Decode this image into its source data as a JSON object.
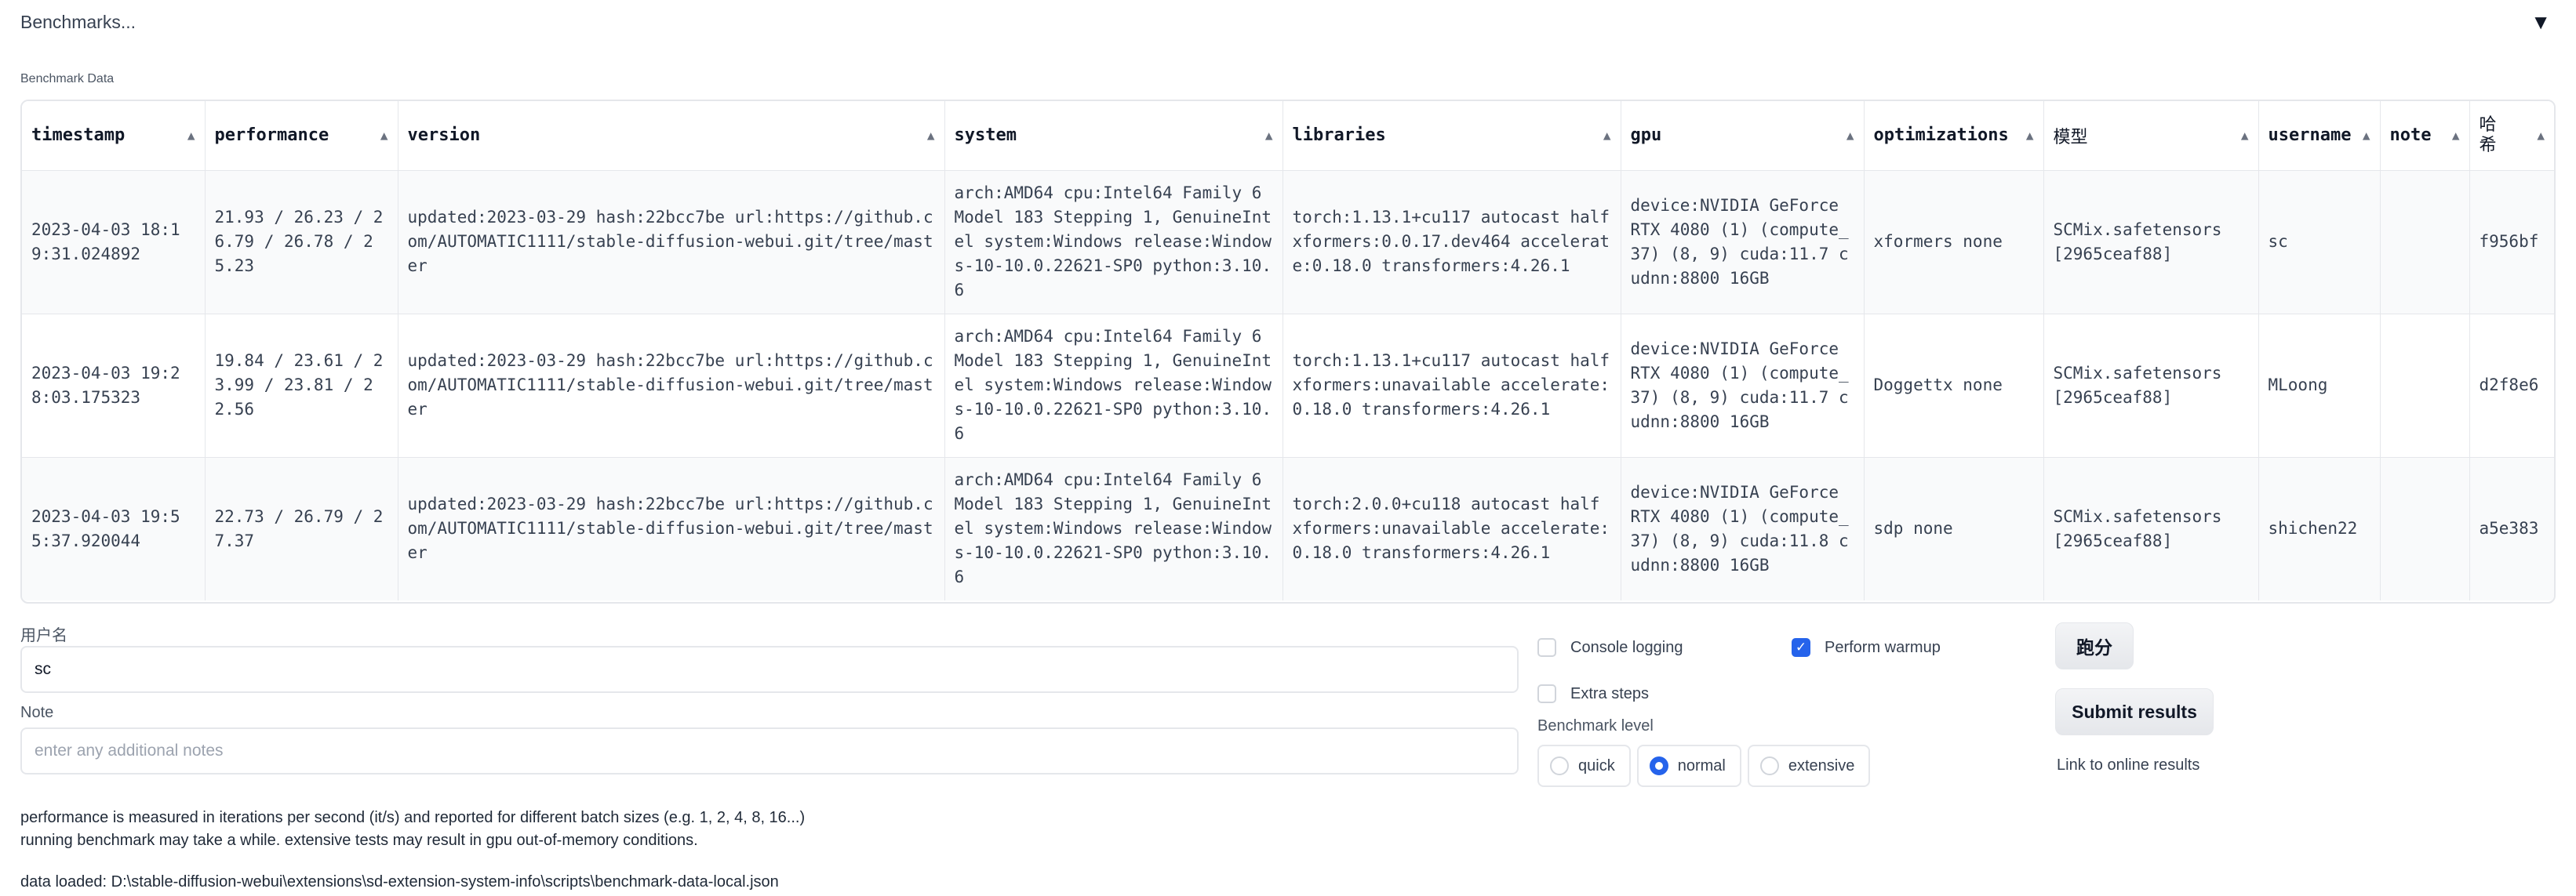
{
  "accordion": {
    "title": "Benchmarks...",
    "caret": "▼"
  },
  "block_label": "Benchmark Data",
  "table": {
    "headers": [
      "timestamp",
      "performance",
      "version",
      "system",
      "libraries",
      "gpu",
      "optimizations",
      "模型",
      "username",
      "note",
      "哈希"
    ],
    "sort_icon": "▲",
    "rows": [
      [
        "2023-04-03 18:19:31.024892",
        "21.93 / 26.23 / 26.79 / 26.78 / 25.23",
        "updated:2023-03-29 hash:22bcc7be url:https://github.com/AUTOMATIC1111/stable-diffusion-webui.git/tree/master",
        "arch:AMD64 cpu:Intel64 Family 6 Model 183 Stepping 1, GenuineIntel system:Windows release:Windows-10-10.0.22621-SP0 python:3.10.6",
        "torch:1.13.1+cu117 autocast half xformers:0.0.17.dev464 accelerate:0.18.0 transformers:4.26.1",
        "device:NVIDIA GeForce RTX 4080 (1) (compute_37) (8, 9) cuda:11.7 cudnn:8800 16GB",
        "xformers none",
        "SCMix.safetensors [2965ceaf88]",
        "sc",
        "",
        "f956bf"
      ],
      [
        "2023-04-03 19:28:03.175323",
        "19.84 / 23.61 / 23.99 / 23.81 / 22.56",
        "updated:2023-03-29 hash:22bcc7be url:https://github.com/AUTOMATIC1111/stable-diffusion-webui.git/tree/master",
        "arch:AMD64 cpu:Intel64 Family 6 Model 183 Stepping 1, GenuineIntel system:Windows release:Windows-10-10.0.22621-SP0 python:3.10.6",
        "torch:1.13.1+cu117 autocast half xformers:unavailable accelerate:0.18.0 transformers:4.26.1",
        "device:NVIDIA GeForce RTX 4080 (1) (compute_37) (8, 9) cuda:11.7 cudnn:8800 16GB",
        "Doggettx none",
        "SCMix.safetensors [2965ceaf88]",
        "MLoong",
        "",
        "d2f8e6"
      ],
      [
        "2023-04-03 19:55:37.920044",
        "22.73 / 26.79 / 27.37",
        "updated:2023-03-29 hash:22bcc7be url:https://github.com/AUTOMATIC1111/stable-diffusion-webui.git/tree/master",
        "arch:AMD64 cpu:Intel64 Family 6 Model 183 Stepping 1, GenuineIntel system:Windows release:Windows-10-10.0.22621-SP0 python:3.10.6",
        "torch:2.0.0+cu118 autocast half xformers:unavailable accelerate:0.18.0 transformers:4.26.1",
        "device:NVIDIA GeForce RTX 4080 (1) (compute_37) (8, 9) cuda:11.8 cudnn:8800 16GB",
        "sdp none",
        "SCMix.safetensors [2965ceaf88]",
        "shichen22",
        "",
        "a5e383"
      ]
    ]
  },
  "form": {
    "username_label": "用户名",
    "username_value": "sc",
    "note_label": "Note",
    "note_placeholder": "enter any additional notes"
  },
  "options": {
    "console_logging": "Console logging",
    "perform_warmup": "Perform warmup",
    "extra_steps": "Extra steps",
    "benchmark_level_label": "Benchmark level",
    "levels": [
      "quick",
      "normal",
      "extensive"
    ]
  },
  "buttons": {
    "run": "跑分",
    "submit": "Submit results"
  },
  "link_text": "Link to online results",
  "info": {
    "line1": "performance is measured in iterations per second (it/s) and reported for different batch sizes (e.g. 1, 2, 4, 8, 16...)",
    "line2": "running benchmark may take a while. extensive tests may result in gpu out-of-memory conditions.",
    "line3": "data loaded: D:\\stable-diffusion-webui\\extensions\\sd-extension-system-info\\scripts\\benchmark-data-local.json"
  }
}
